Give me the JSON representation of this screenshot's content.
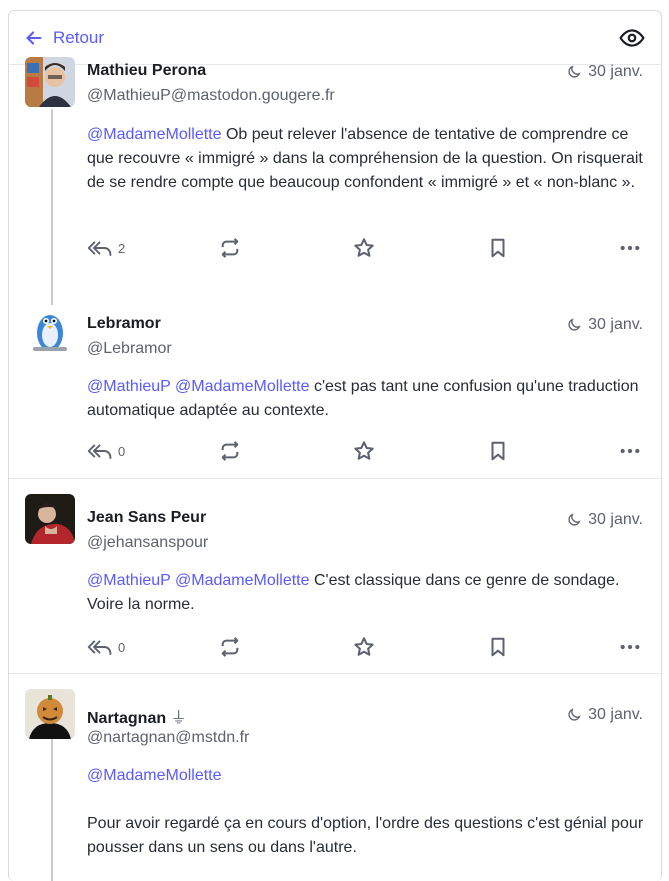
{
  "header": {
    "back_label": "Retour",
    "back_icon": "arrow-left-icon",
    "visibility_icon": "eye-icon"
  },
  "accent": "#595aff",
  "statuses": [
    {
      "name": "Mathieu Perona",
      "acct": "@MathieuP@mastodon.gougere.fr",
      "time": "30 janv.",
      "mentions": [
        "@MadameMollette"
      ],
      "text": " Ob peut relever l'absence de tentative de comprendre ce que recouvre « immigré » dans la compréhension de la question. On risquerait de se rendre compte que beaucoup confondent « immigré » et « non-blanc ».",
      "replies": "2"
    },
    {
      "name": "Lebramor",
      "acct": "@Lebramor",
      "time": "30 janv.",
      "mentions": [
        "@MathieuP",
        "@MadameMollette"
      ],
      "text": " c'est pas tant une confusion qu'une traduction automatique adaptée au contexte.",
      "replies": "0"
    },
    {
      "name": "Jean Sans Peur",
      "acct": "@jehansanspour",
      "time": "30 janv.",
      "mentions": [
        "@MathieuP",
        "@MadameMollette"
      ],
      "text": " C'est classique dans ce genre de sondage. Voire la norme.",
      "replies": "0"
    },
    {
      "name": "Nartagnan",
      "name_badge": "⏚",
      "acct": "@nartagnan@mstdn.fr",
      "time": "30 janv.",
      "mentions": [
        "@MadameMollette"
      ],
      "text": "Pour avoir regardé ça en cours d'option, l'ordre des questions c'est génial pour pousser dans un sens ou dans l'autre."
    }
  ]
}
